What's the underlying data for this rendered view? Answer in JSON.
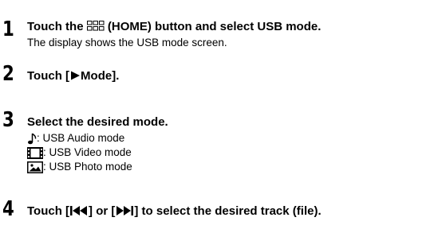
{
  "steps": [
    {
      "number": "1",
      "title_prefix": "Touch the ",
      "title_suffix": " (HOME) button and select USB mode.",
      "body": "The display shows the USB mode screen.",
      "icon": "home-grid-icon"
    },
    {
      "number": "2",
      "title_prefix": "Touch [",
      "title_suffix": "Mode].",
      "icon": "play-triangle-icon"
    },
    {
      "number": "3",
      "title": "Select the desired mode.",
      "modes": [
        {
          "icon": "music-note-icon",
          "label": ": USB Audio mode"
        },
        {
          "icon": "film-strip-icon",
          "label": ": USB Video mode"
        },
        {
          "icon": "photo-icon",
          "label": ": USB Photo mode"
        }
      ]
    },
    {
      "number": "4",
      "title_part1": "Touch [",
      "title_part2": "] or [",
      "title_part3": "] to select the desired track (file).",
      "icons": [
        "previous-track-icon",
        "next-track-icon"
      ]
    }
  ]
}
